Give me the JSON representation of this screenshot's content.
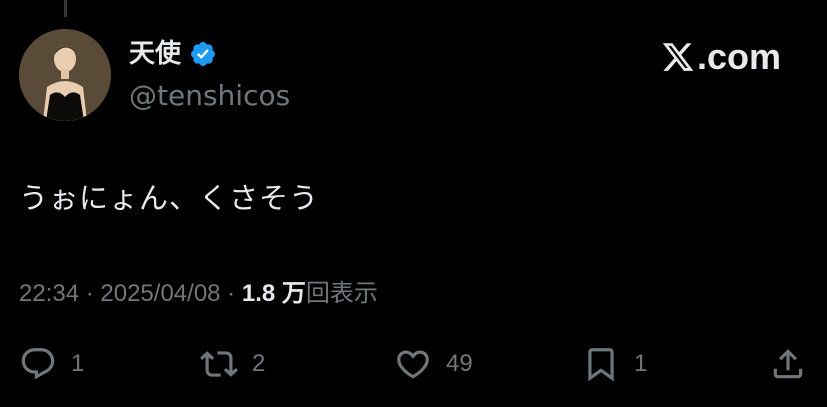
{
  "author": {
    "display_name": "天使",
    "handle": "@tenshicos",
    "verified": true,
    "verified_color": "#1d9bf0"
  },
  "brand": {
    "icon": "x-logo-icon",
    "domain": ".com"
  },
  "tweet": {
    "text": "うぉにょん、くさそう"
  },
  "meta": {
    "time": "22:34",
    "separator": " · ",
    "date": "2025/04/08",
    "views_count": "1.8 万",
    "views_label": "回表示"
  },
  "actions": {
    "reply": {
      "icon": "reply-icon",
      "count": "1"
    },
    "repost": {
      "icon": "repost-icon",
      "count": "2"
    },
    "like": {
      "icon": "heart-icon",
      "count": "49"
    },
    "bookmark": {
      "icon": "bookmark-icon",
      "count": "1"
    },
    "share": {
      "icon": "share-icon"
    }
  },
  "colors": {
    "background": "#000000",
    "primary_text": "#e7e9ea",
    "secondary_text": "#71767b"
  }
}
